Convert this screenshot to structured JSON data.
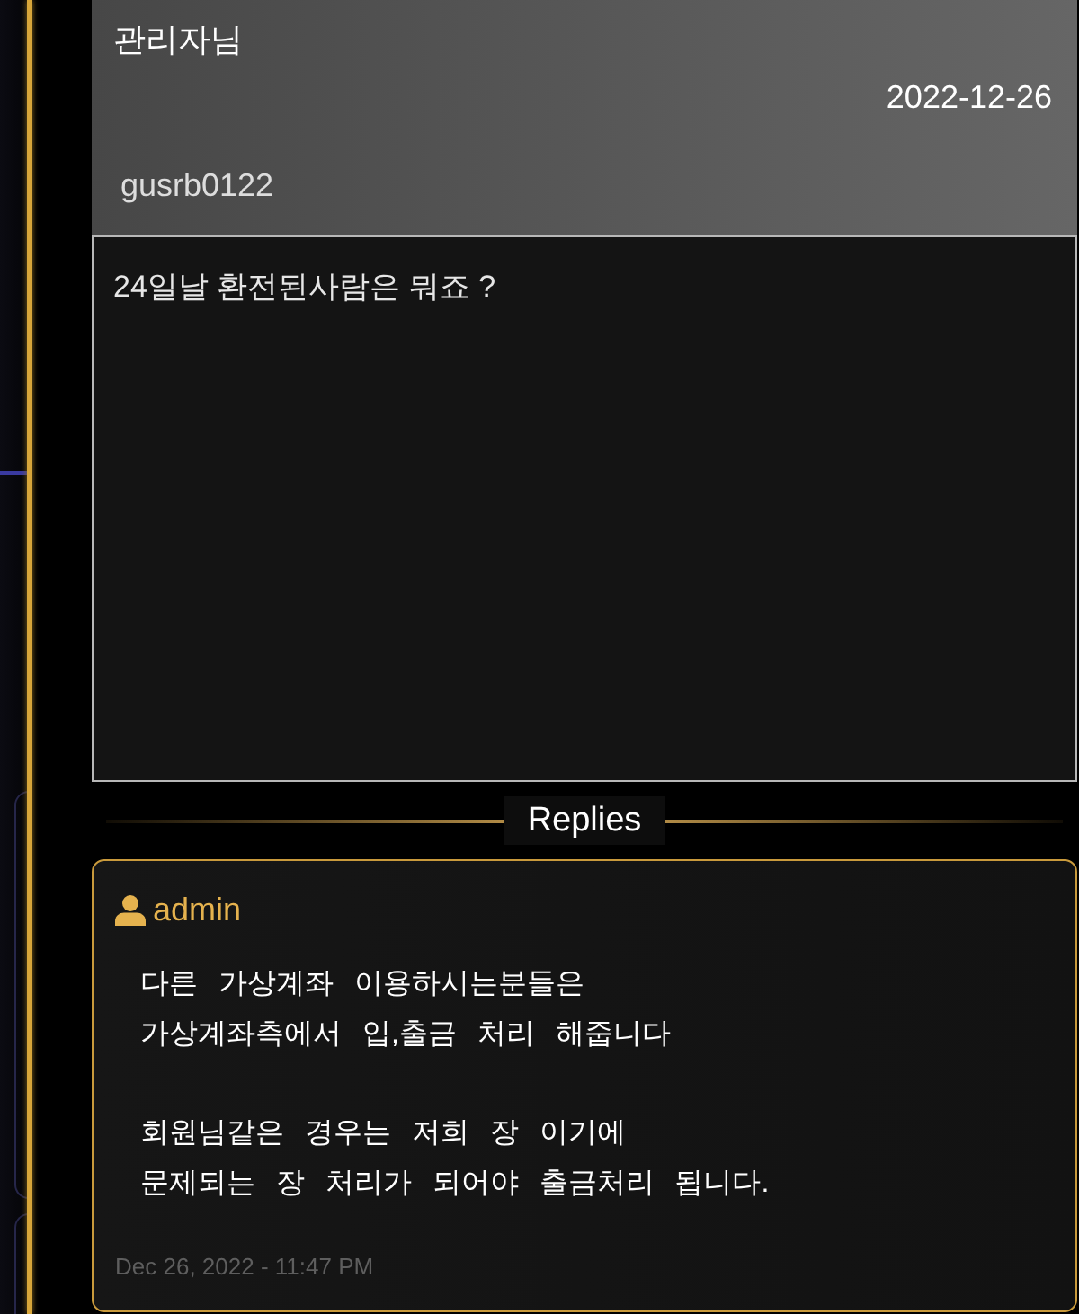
{
  "post": {
    "title": "관리자님",
    "date": "2022-12-26",
    "author": "gusrb0122",
    "content": "24일날 환전된사람은 뭐죠 ?"
  },
  "replies_heading": "Replies",
  "replies": [
    {
      "author": "admin",
      "paragraphs": [
        "다른 가상계좌 이용하시는분들은\n가상계좌측에서 입,출금 처리 해줍니다",
        "회원님같은 경우는 저희 장 이기에\n문제되는 장 처리가 되어야 출금처리 됩니다."
      ],
      "time": "Dec 26, 2022 - 11:47 PM"
    }
  ]
}
